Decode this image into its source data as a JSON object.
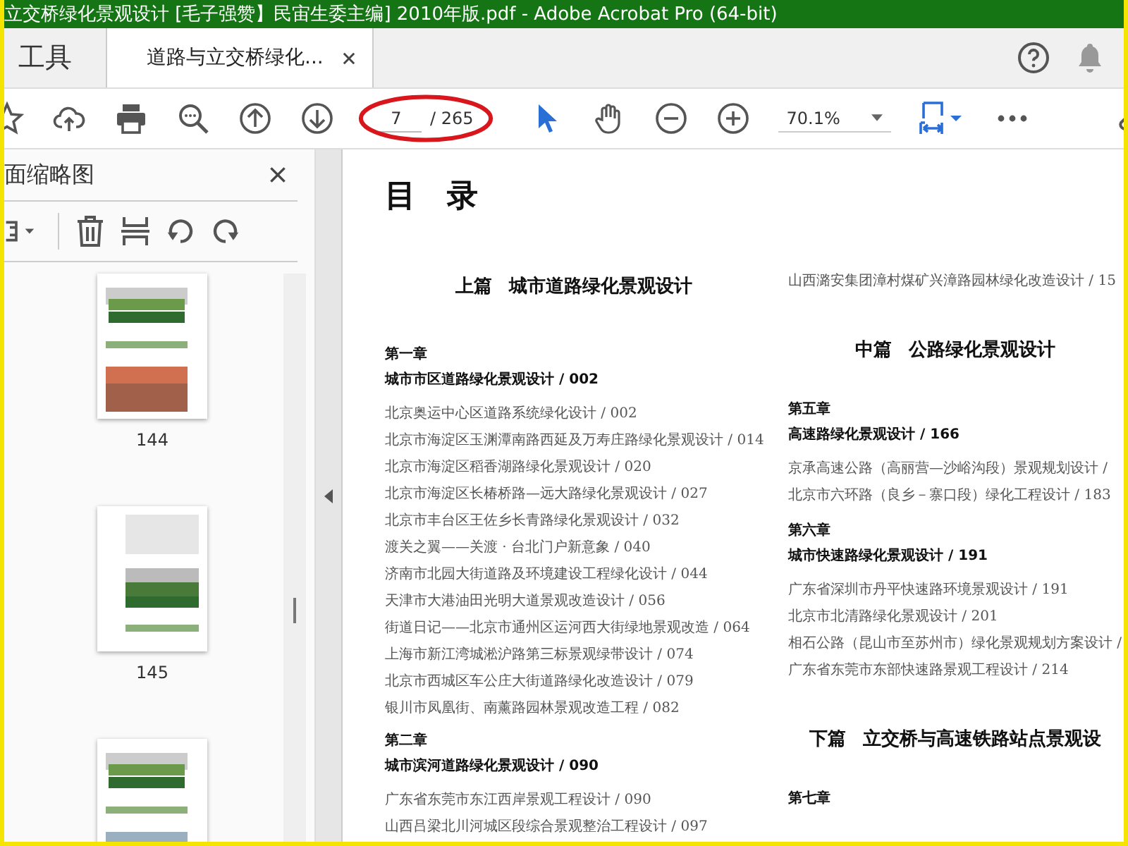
{
  "window": {
    "title": "立交桥绿化景观设计 [毛子强赞】民宙生委主编] 2010年版.pdf - Adobe Acrobat Pro (64-bit)"
  },
  "tabs": [
    {
      "label": "工具",
      "selected": false,
      "kind": "home"
    },
    {
      "label": "道路与立交桥绿化...",
      "selected": true,
      "kind": "document"
    }
  ],
  "toolbar": {
    "tools": [
      {
        "kind": "star",
        "selected": false
      },
      {
        "kind": "upload",
        "selected": false
      },
      {
        "kind": "print",
        "selected": false
      },
      {
        "kind": "find",
        "selected": false
      },
      {
        "kind": "prev",
        "selected": false
      },
      {
        "kind": "next",
        "selected": false
      },
      {
        "kind": "page"
      },
      {
        "kind": "select",
        "selected": true
      },
      {
        "kind": "hand",
        "selected": false
      },
      {
        "kind": "zoom-out",
        "selected": false
      },
      {
        "kind": "zoom-in",
        "selected": false
      },
      {
        "kind": "zoom"
      },
      {
        "kind": "fit"
      },
      {
        "kind": "more",
        "selected": false
      },
      {
        "kind": "link",
        "selected": false
      }
    ],
    "page_current": "7",
    "page_total": "/ 265",
    "zoom_value": "70.1%"
  },
  "sidebar": {
    "title": "面缩略图",
    "thumbnails": [
      {
        "kind": "picture",
        "label": "144"
      },
      {
        "kind": "picture",
        "label": "145"
      },
      {
        "kind": "picture"
      }
    ]
  },
  "document": {
    "heading": "目录",
    "left": [
      {
        "kind": "part",
        "label": "上篇",
        "title": "城市道路绿化景观设计"
      },
      {
        "kind": "chapter",
        "number": "第一章",
        "title": "城市市区道路绿化景观设计 / 002"
      },
      {
        "kind": "entry",
        "text": "北京奥运中心区道路系统绿化设计 / 002"
      },
      {
        "kind": "entry",
        "text": "北京市海淀区玉渊潭南路西延及万寿庄路绿化景观设计 / 014"
      },
      {
        "kind": "entry",
        "text": "北京市海淀区稻香湖路绿化景观设计 / 020"
      },
      {
        "kind": "entry",
        "text": "北京市海淀区长椿桥路—远大路绿化景观设计 / 027"
      },
      {
        "kind": "entry",
        "text": "北京市丰台区王佐乡长青路绿化景观设计 / 032"
      },
      {
        "kind": "entry",
        "text": "渡关之翼——关渡 · 台北门户新意象 / 040"
      },
      {
        "kind": "entry",
        "text": "济南市北园大街道路及环境建设工程绿化设计 / 044"
      },
      {
        "kind": "entry",
        "text": "天津市大港油田光明大道景观改造设计 / 056"
      },
      {
        "kind": "entry",
        "text": "街道日记——北京市通州区运河西大街绿地景观改造 / 064"
      },
      {
        "kind": "entry",
        "text": "上海市新江湾城淞沪路第三标景观绿带设计 / 074"
      },
      {
        "kind": "entry",
        "text": "北京市西城区车公庄大街道路绿化改造设计 / 079"
      },
      {
        "kind": "entry",
        "text": "银川市凤凰街、南薰路园林景观改造工程 / 082"
      },
      {
        "kind": "chapter",
        "number": "第二章",
        "title": "城市滨河道路绿化景观设计 / 090"
      },
      {
        "kind": "entry",
        "text": "广东省东莞市东江西岸景观工程设计 / 090"
      },
      {
        "kind": "entry",
        "text": "山西吕梁北川河城区段综合景观整治工程设计 / 097"
      }
    ],
    "right": [
      {
        "kind": "entry",
        "text": "山西潞安集团漳村煤矿兴漳路园林绿化改造设计 / 15"
      },
      {
        "kind": "part",
        "label": "中篇",
        "title": "公路绿化景观设计"
      },
      {
        "kind": "chapter",
        "number": "第五章",
        "title": "高速路绿化景观设计 / 166"
      },
      {
        "kind": "entry",
        "text": "京承高速公路（高丽营—沙峪沟段）景观规划设计 /"
      },
      {
        "kind": "entry",
        "text": "北京市六环路（良乡－寨口段）绿化工程设计 / 183"
      },
      {
        "kind": "chapter",
        "number": "第六章",
        "title": "城市快速路绿化景观设计 / 191"
      },
      {
        "kind": "entry",
        "text": "广东省深圳市丹平快速路环境景观设计 / 191"
      },
      {
        "kind": "entry",
        "text": "北京市北清路绿化景观设计 / 201"
      },
      {
        "kind": "entry",
        "text": "相石公路（昆山市至苏州市）绿化景观规划方案设计 /"
      },
      {
        "kind": "entry",
        "text": "广东省东莞市东部快速路景观工程设计 / 214"
      },
      {
        "kind": "part",
        "label": "下篇",
        "title": "立交桥与高速铁路站点景观设"
      },
      {
        "kind": "chapter",
        "number": "第七章"
      }
    ]
  }
}
